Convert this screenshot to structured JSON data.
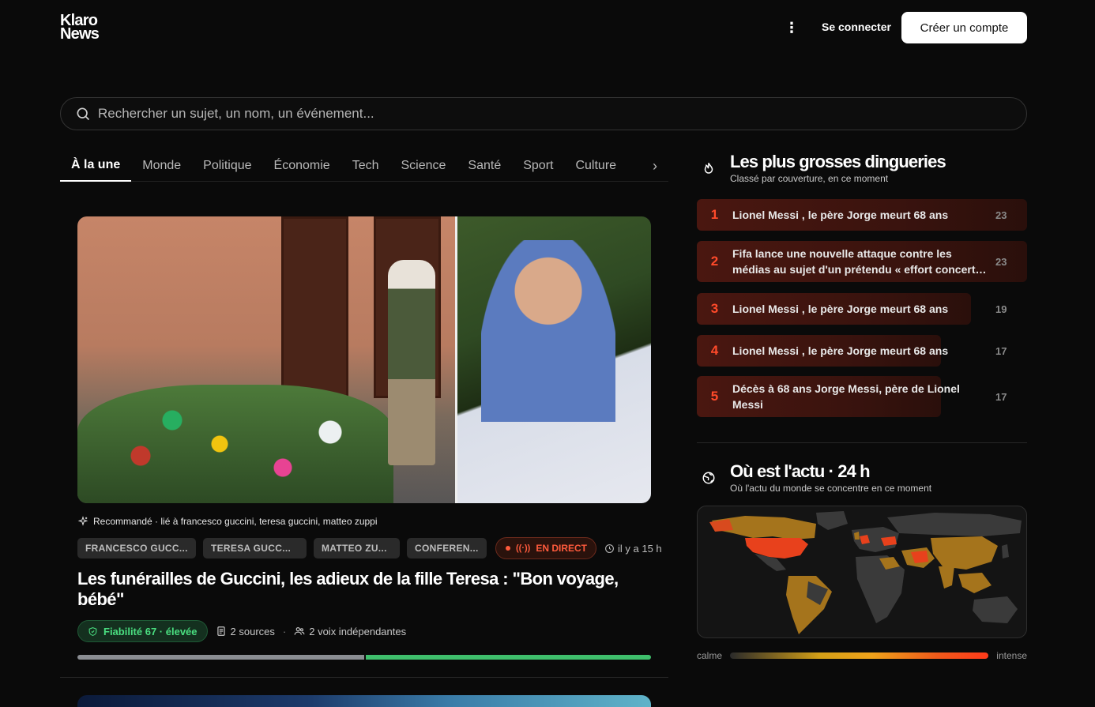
{
  "header": {
    "logo_line1": "Klaro",
    "logo_line2": "News",
    "login_label": "Se connecter",
    "signup_label": "Créer un compte"
  },
  "search": {
    "placeholder": "Rechercher un sujet, un nom, un événement..."
  },
  "tabs": [
    {
      "label": "À la une",
      "active": true
    },
    {
      "label": "Monde"
    },
    {
      "label": "Politique"
    },
    {
      "label": "Économie"
    },
    {
      "label": "Tech"
    },
    {
      "label": "Science"
    },
    {
      "label": "Santé"
    },
    {
      "label": "Sport"
    },
    {
      "label": "Culture"
    }
  ],
  "article": {
    "recommendation": "Recommandé · lié à francesco guccini, teresa guccini, matteo zuppi",
    "chips": [
      "FRANCESCO GUCC...",
      "TERESA GUCC...",
      "MATTEO ZU...",
      "CONFEREN..."
    ],
    "live_label": "EN DIRECT",
    "time_label": "il y a 15 h",
    "title": "Les funérailles de Guccini, les adieux de la fille Teresa : \"Bon voyage, bébé\"",
    "reliability_label": "Fiabilité 67 · élevée",
    "sources_label": "2 sources",
    "separator": "·",
    "voices_label": "2 voix indépendantes",
    "bias_split": 0.5
  },
  "trending": {
    "title": "Les plus grosses dingueries",
    "subtitle": "Classé par couverture, en ce moment",
    "items": [
      {
        "rank": "1",
        "text": "Lionel Messi , le père Jorge meurt 68 ans",
        "count": "23",
        "coverage": 1.0
      },
      {
        "rank": "2",
        "text": "Fifa lance une nouvelle attaque contre les médias au sujet d'un prétendu « effort concerté » visant à nuire à la Coupe du monde",
        "count": "23",
        "coverage": 1.0
      },
      {
        "rank": "3",
        "text": "Lionel Messi , le père Jorge meurt 68 ans",
        "count": "19",
        "coverage": 0.83
      },
      {
        "rank": "4",
        "text": "Lionel Messi , le père Jorge meurt 68 ans",
        "count": "17",
        "coverage": 0.74
      },
      {
        "rank": "5",
        "text": "Décès à 68 ans Jorge Messi, père de Lionel Messi",
        "count": "17",
        "coverage": 0.74
      }
    ]
  },
  "heatmap": {
    "title": "Où est l'actu · 24 h",
    "subtitle": "Où l'actu du monde se concentre en ce moment",
    "legend_low": "calme",
    "legend_high": "intense"
  },
  "colors": {
    "accent_red": "#ff4a2a",
    "reliability_green": "#4ade80",
    "live_red": "#ff5a3c"
  }
}
